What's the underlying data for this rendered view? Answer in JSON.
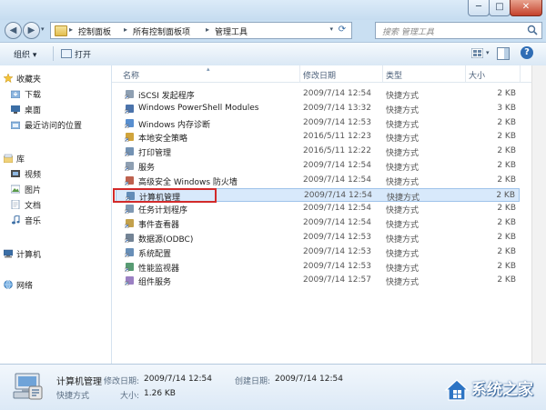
{
  "window": {
    "min_label": "─",
    "max_label": "□",
    "close_label": "✕"
  },
  "address": {
    "back_glyph": "◀",
    "fwd_glyph": "▶",
    "breadcrumb": [
      "控制面板",
      "所有控制面板项",
      "管理工具"
    ],
    "separator": "▸",
    "search_placeholder": "搜索 管理工具"
  },
  "toolbar": {
    "organize_label": "组织 ▾",
    "open_label": "打开",
    "help_label": "?"
  },
  "nav": {
    "favorites_label": "收藏夹",
    "favorites_items": [
      "下载",
      "桌面",
      "最近访问的位置"
    ],
    "libraries_label": "库",
    "libraries_items": [
      "视频",
      "图片",
      "文档",
      "音乐"
    ],
    "computer_label": "计算机",
    "network_label": "网络"
  },
  "columns": {
    "name": "名称",
    "modified": "修改日期",
    "type": "类型",
    "size": "大小"
  },
  "files": [
    {
      "name": "iSCSI 发起程序",
      "date": "2009/7/14 12:54",
      "type": "快捷方式",
      "size": "2 KB"
    },
    {
      "name": "Windows PowerShell Modules",
      "date": "2009/7/14 13:32",
      "type": "快捷方式",
      "size": "3 KB"
    },
    {
      "name": "Windows 内存诊断",
      "date": "2009/7/14 12:53",
      "type": "快捷方式",
      "size": "2 KB"
    },
    {
      "name": "本地安全策略",
      "date": "2016/5/11 12:23",
      "type": "快捷方式",
      "size": "2 KB"
    },
    {
      "name": "打印管理",
      "date": "2016/5/11 12:22",
      "type": "快捷方式",
      "size": "2 KB"
    },
    {
      "name": "服务",
      "date": "2009/7/14 12:54",
      "type": "快捷方式",
      "size": "2 KB"
    },
    {
      "name": "高级安全 Windows 防火墙",
      "date": "2009/7/14 12:54",
      "type": "快捷方式",
      "size": "2 KB"
    },
    {
      "name": "计算机管理",
      "date": "2009/7/14 12:54",
      "type": "快捷方式",
      "size": "2 KB"
    },
    {
      "name": "任务计划程序",
      "date": "2009/7/14 12:54",
      "type": "快捷方式",
      "size": "2 KB"
    },
    {
      "name": "事件查看器",
      "date": "2009/7/14 12:54",
      "type": "快捷方式",
      "size": "2 KB"
    },
    {
      "name": "数据源(ODBC)",
      "date": "2009/7/14 12:53",
      "type": "快捷方式",
      "size": "2 KB"
    },
    {
      "name": "系统配置",
      "date": "2009/7/14 12:53",
      "type": "快捷方式",
      "size": "2 KB"
    },
    {
      "name": "性能监视器",
      "date": "2009/7/14 12:53",
      "type": "快捷方式",
      "size": "2 KB"
    },
    {
      "name": "组件服务",
      "date": "2009/7/14 12:57",
      "type": "快捷方式",
      "size": "2 KB"
    }
  ],
  "selected_index": 7,
  "details": {
    "name": "计算机管理",
    "type": "快捷方式",
    "modified_label": "修改日期:",
    "modified_value": "2009/7/14 12:54",
    "created_label": "创建日期:",
    "created_value": "2009/7/14 12:54",
    "size_label": "大小:",
    "size_value": "1.26 KB"
  },
  "watermark": {
    "text": "系统之家"
  },
  "colors": {
    "accent": "#2f6db5",
    "selection": "#d8e9fb",
    "highlight_border": "#d22a2a"
  }
}
